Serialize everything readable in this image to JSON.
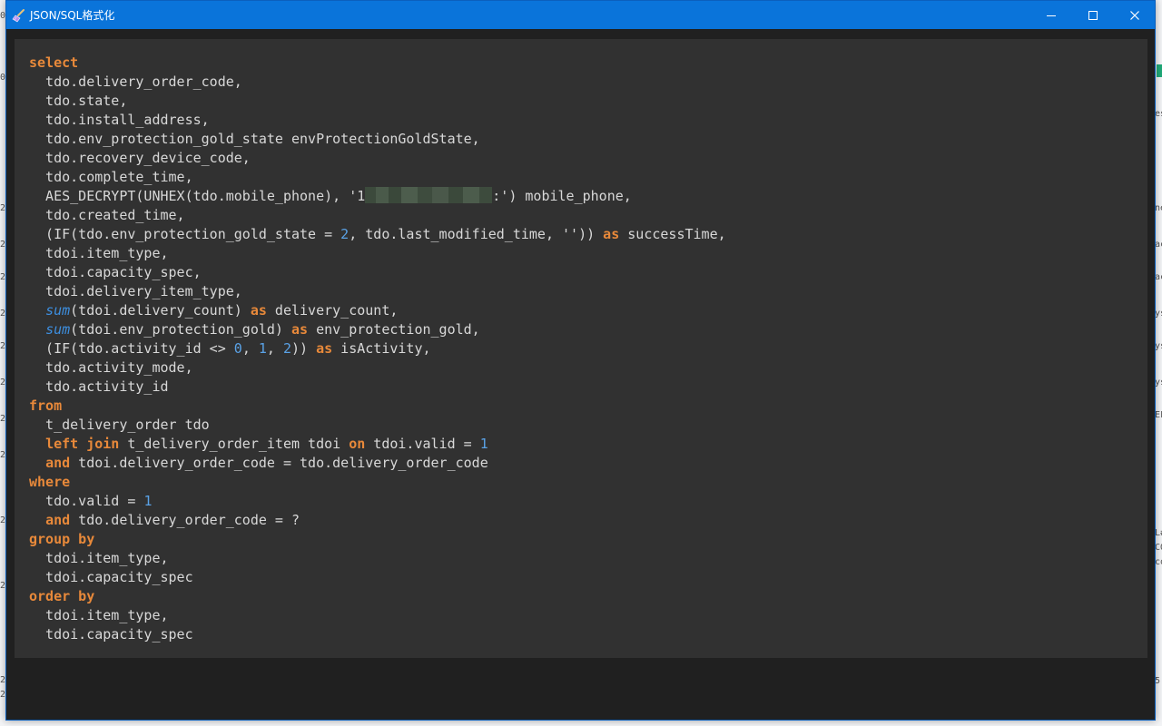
{
  "window": {
    "title": "JSON/SQL格式化",
    "icon": "broom-icon",
    "controls": [
      "minimize-icon",
      "maximize-icon",
      "close-icon"
    ],
    "titlebar_color": "#0a74da"
  },
  "colors": {
    "keyword": "#e8893a",
    "function": "#3d8fe0",
    "number": "#5aa2e6",
    "text": "#d8d8d8",
    "panel": "#313131",
    "window_bg": "#202020"
  },
  "background_app": {
    "left_edge_marks": [
      "0",
      "0",
      "2",
      "2",
      "2",
      "2",
      "2",
      "2",
      "2",
      "2",
      "2",
      "2",
      "2",
      "2"
    ],
    "right_edge_marks": [
      "es",
      "ne",
      "ac",
      "ac",
      "ys",
      "ys",
      "ys",
      "EF",
      "L#",
      "CO",
      "co",
      "5"
    ]
  },
  "code_lines": [
    [
      {
        "t": "kw",
        "v": "select"
      }
    ],
    [
      {
        "t": "txt",
        "v": "  tdo.delivery_order_code,"
      }
    ],
    [
      {
        "t": "txt",
        "v": "  tdo.state,"
      }
    ],
    [
      {
        "t": "txt",
        "v": "  tdo.install_address,"
      }
    ],
    [
      {
        "t": "txt",
        "v": "  tdo.env_protection_gold_state envProtectionGoldState,"
      }
    ],
    [
      {
        "t": "txt",
        "v": "  tdo.recovery_device_code,"
      }
    ],
    [
      {
        "t": "txt",
        "v": "  tdo.complete_time,"
      }
    ],
    [
      {
        "t": "txt",
        "v": "  AES_DECRYPT(UNHEX(tdo.mobile_phone), '1"
      },
      {
        "t": "redact",
        "v": ""
      },
      {
        "t": "txt",
        "v": ":') mobile_phone,"
      }
    ],
    [
      {
        "t": "txt",
        "v": "  tdo.created_time,"
      }
    ],
    [
      {
        "t": "txt",
        "v": "  (IF(tdo.env_protection_gold_state = "
      },
      {
        "t": "num",
        "v": "2"
      },
      {
        "t": "txt",
        "v": ", tdo.last_modified_time, '')) "
      },
      {
        "t": "kw",
        "v": "as"
      },
      {
        "t": "txt",
        "v": " successTime,"
      }
    ],
    [
      {
        "t": "txt",
        "v": "  tdoi.item_type,"
      }
    ],
    [
      {
        "t": "txt",
        "v": "  tdoi.capacity_spec,"
      }
    ],
    [
      {
        "t": "txt",
        "v": "  tdoi.delivery_item_type,"
      }
    ],
    [
      {
        "t": "txt",
        "v": "  "
      },
      {
        "t": "fn",
        "v": "sum"
      },
      {
        "t": "txt",
        "v": "(tdoi.delivery_count) "
      },
      {
        "t": "kw",
        "v": "as"
      },
      {
        "t": "txt",
        "v": " delivery_count,"
      }
    ],
    [
      {
        "t": "txt",
        "v": "  "
      },
      {
        "t": "fn",
        "v": "sum"
      },
      {
        "t": "txt",
        "v": "(tdoi.env_protection_gold) "
      },
      {
        "t": "kw",
        "v": "as"
      },
      {
        "t": "txt",
        "v": " env_protection_gold,"
      }
    ],
    [
      {
        "t": "txt",
        "v": "  (IF(tdo.activity_id <> "
      },
      {
        "t": "num",
        "v": "0"
      },
      {
        "t": "txt",
        "v": ", "
      },
      {
        "t": "num",
        "v": "1"
      },
      {
        "t": "txt",
        "v": ", "
      },
      {
        "t": "num",
        "v": "2"
      },
      {
        "t": "txt",
        "v": ")) "
      },
      {
        "t": "kw",
        "v": "as"
      },
      {
        "t": "txt",
        "v": " isActivity,"
      }
    ],
    [
      {
        "t": "txt",
        "v": "  tdo.activity_mode,"
      }
    ],
    [
      {
        "t": "txt",
        "v": "  tdo.activity_id"
      }
    ],
    [
      {
        "t": "kw",
        "v": "from"
      }
    ],
    [
      {
        "t": "txt",
        "v": "  t_delivery_order tdo"
      }
    ],
    [
      {
        "t": "txt",
        "v": "  "
      },
      {
        "t": "kw",
        "v": "left join"
      },
      {
        "t": "txt",
        "v": " t_delivery_order_item tdoi "
      },
      {
        "t": "kw",
        "v": "on"
      },
      {
        "t": "txt",
        "v": " tdoi.valid = "
      },
      {
        "t": "num",
        "v": "1"
      }
    ],
    [
      {
        "t": "txt",
        "v": "  "
      },
      {
        "t": "kw",
        "v": "and"
      },
      {
        "t": "txt",
        "v": " tdoi.delivery_order_code = tdo.delivery_order_code"
      }
    ],
    [
      {
        "t": "kw",
        "v": "where"
      }
    ],
    [
      {
        "t": "txt",
        "v": "  tdo.valid = "
      },
      {
        "t": "num",
        "v": "1"
      }
    ],
    [
      {
        "t": "txt",
        "v": "  "
      },
      {
        "t": "kw",
        "v": "and"
      },
      {
        "t": "txt",
        "v": " tdo.delivery_order_code = ?"
      }
    ],
    [
      {
        "t": "kw",
        "v": "group by"
      }
    ],
    [
      {
        "t": "txt",
        "v": "  tdoi.item_type,"
      }
    ],
    [
      {
        "t": "txt",
        "v": "  tdoi.capacity_spec"
      }
    ],
    [
      {
        "t": "kw",
        "v": "order by"
      }
    ],
    [
      {
        "t": "txt",
        "v": "  tdoi.item_type,"
      }
    ],
    [
      {
        "t": "txt",
        "v": "  tdoi.capacity_spec"
      }
    ]
  ]
}
